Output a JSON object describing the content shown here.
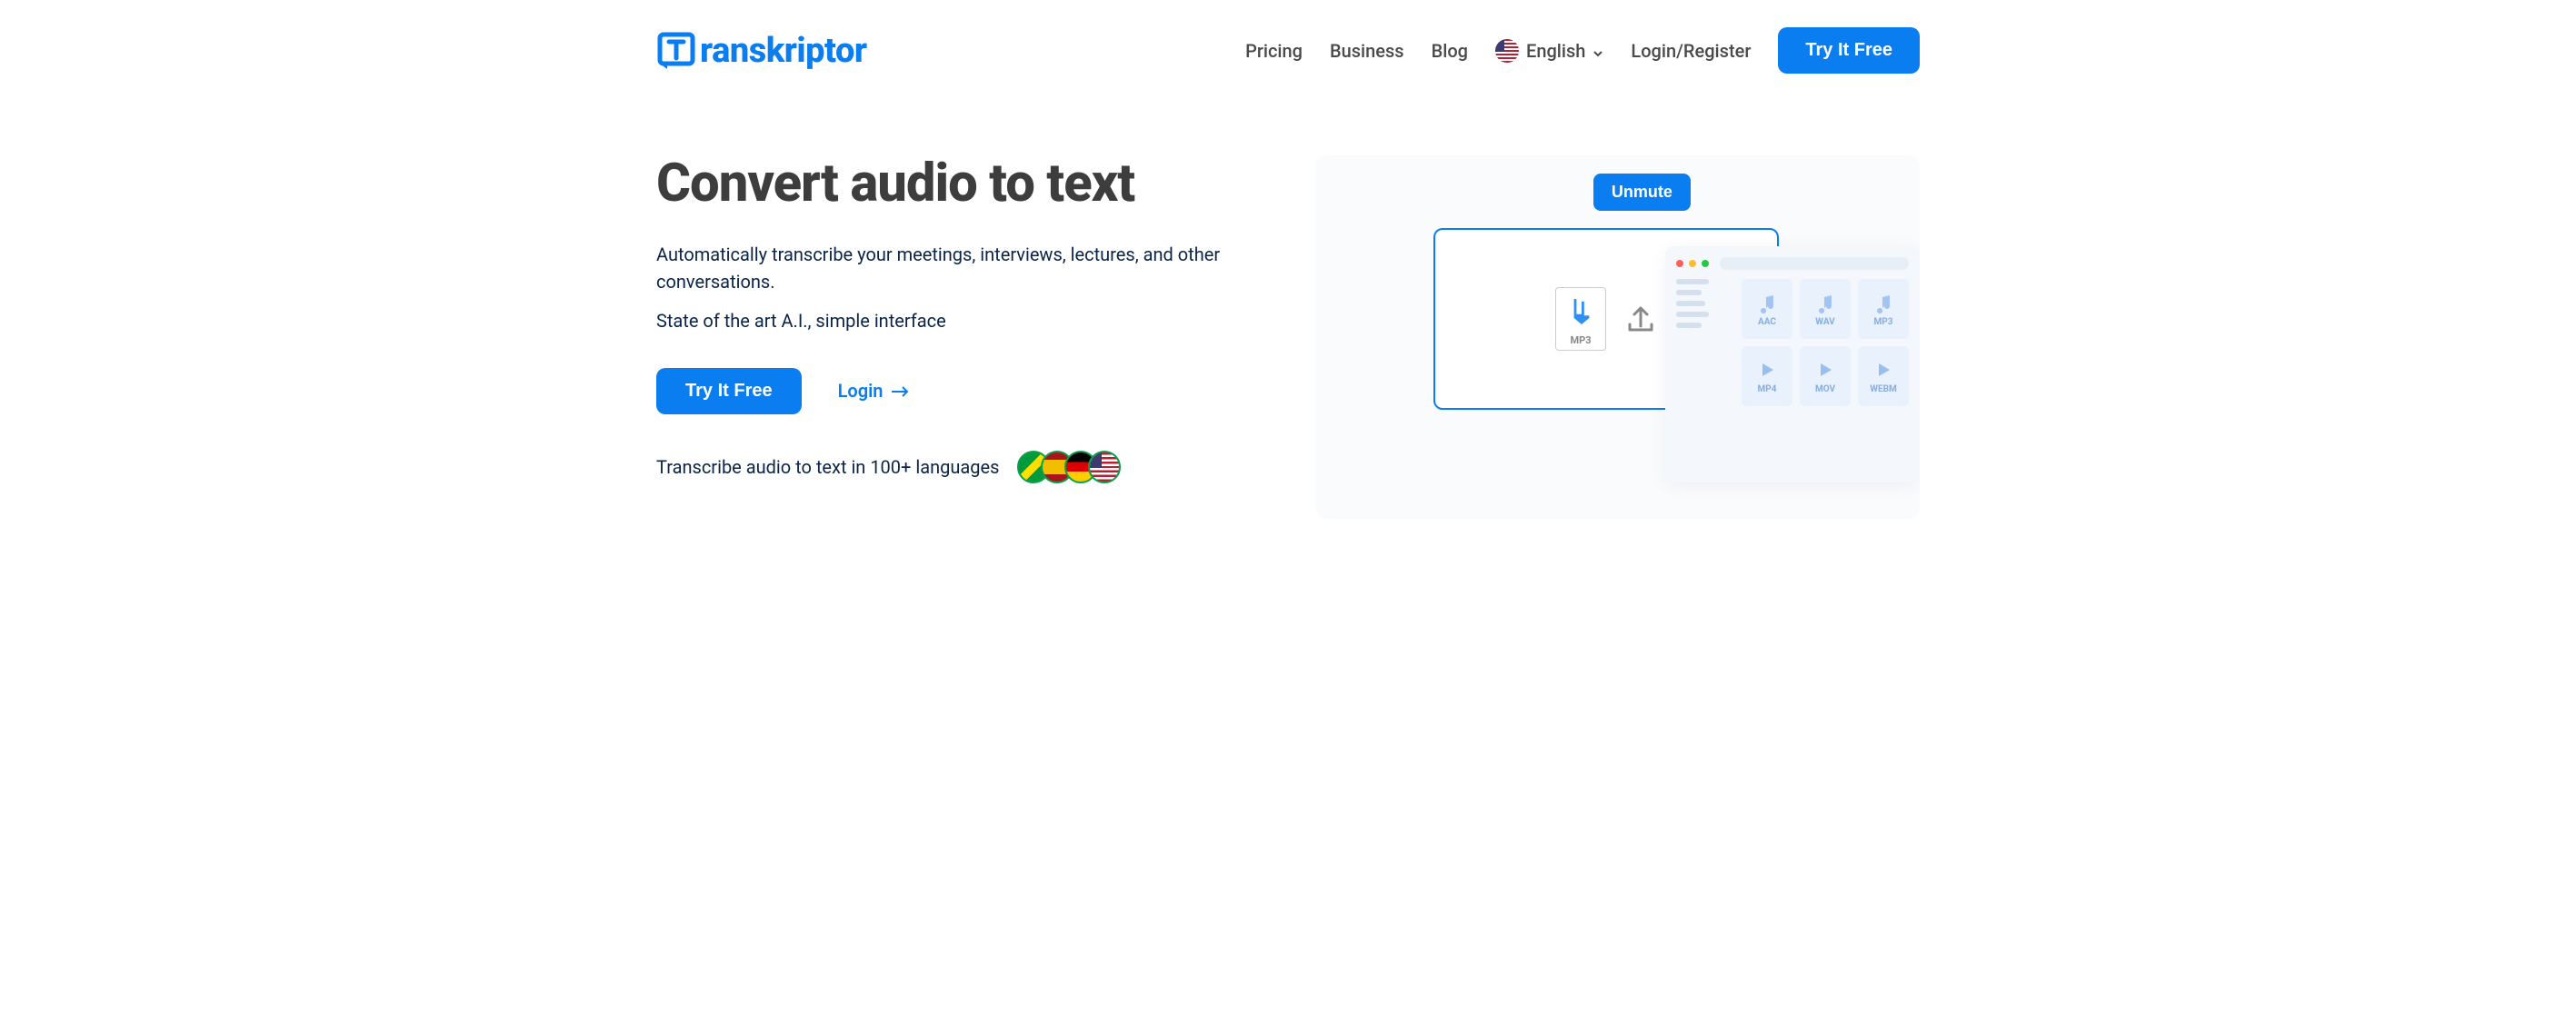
{
  "brand": {
    "name": "ranskriptor"
  },
  "nav": {
    "pricing": "Pricing",
    "business": "Business",
    "blog": "Blog",
    "language": "English",
    "login_register": "Login/Register",
    "cta": "Try It Free"
  },
  "hero": {
    "title": "Convert audio to text",
    "sub1": "Automatically transcribe your meetings, interviews, lectures, and other conversations.",
    "sub2": "State of the art A.I., simple interface",
    "cta": "Try It Free",
    "login": "Login",
    "langs_text": "Transcribe audio to text in 100+ languages",
    "unmute": "Unmute"
  },
  "illustration": {
    "drop_file_label": "MP3",
    "formats": [
      {
        "label": "AAC",
        "type": "audio"
      },
      {
        "label": "WAV",
        "type": "audio"
      },
      {
        "label": "MP3",
        "type": "audio"
      },
      {
        "label": "MP4",
        "type": "video"
      },
      {
        "label": "MOV",
        "type": "video"
      },
      {
        "label": "WEBM",
        "type": "video"
      }
    ]
  },
  "colors": {
    "primary": "#0a7df0",
    "text_dark": "#3d3d3d",
    "text_navy": "#0b2447"
  }
}
